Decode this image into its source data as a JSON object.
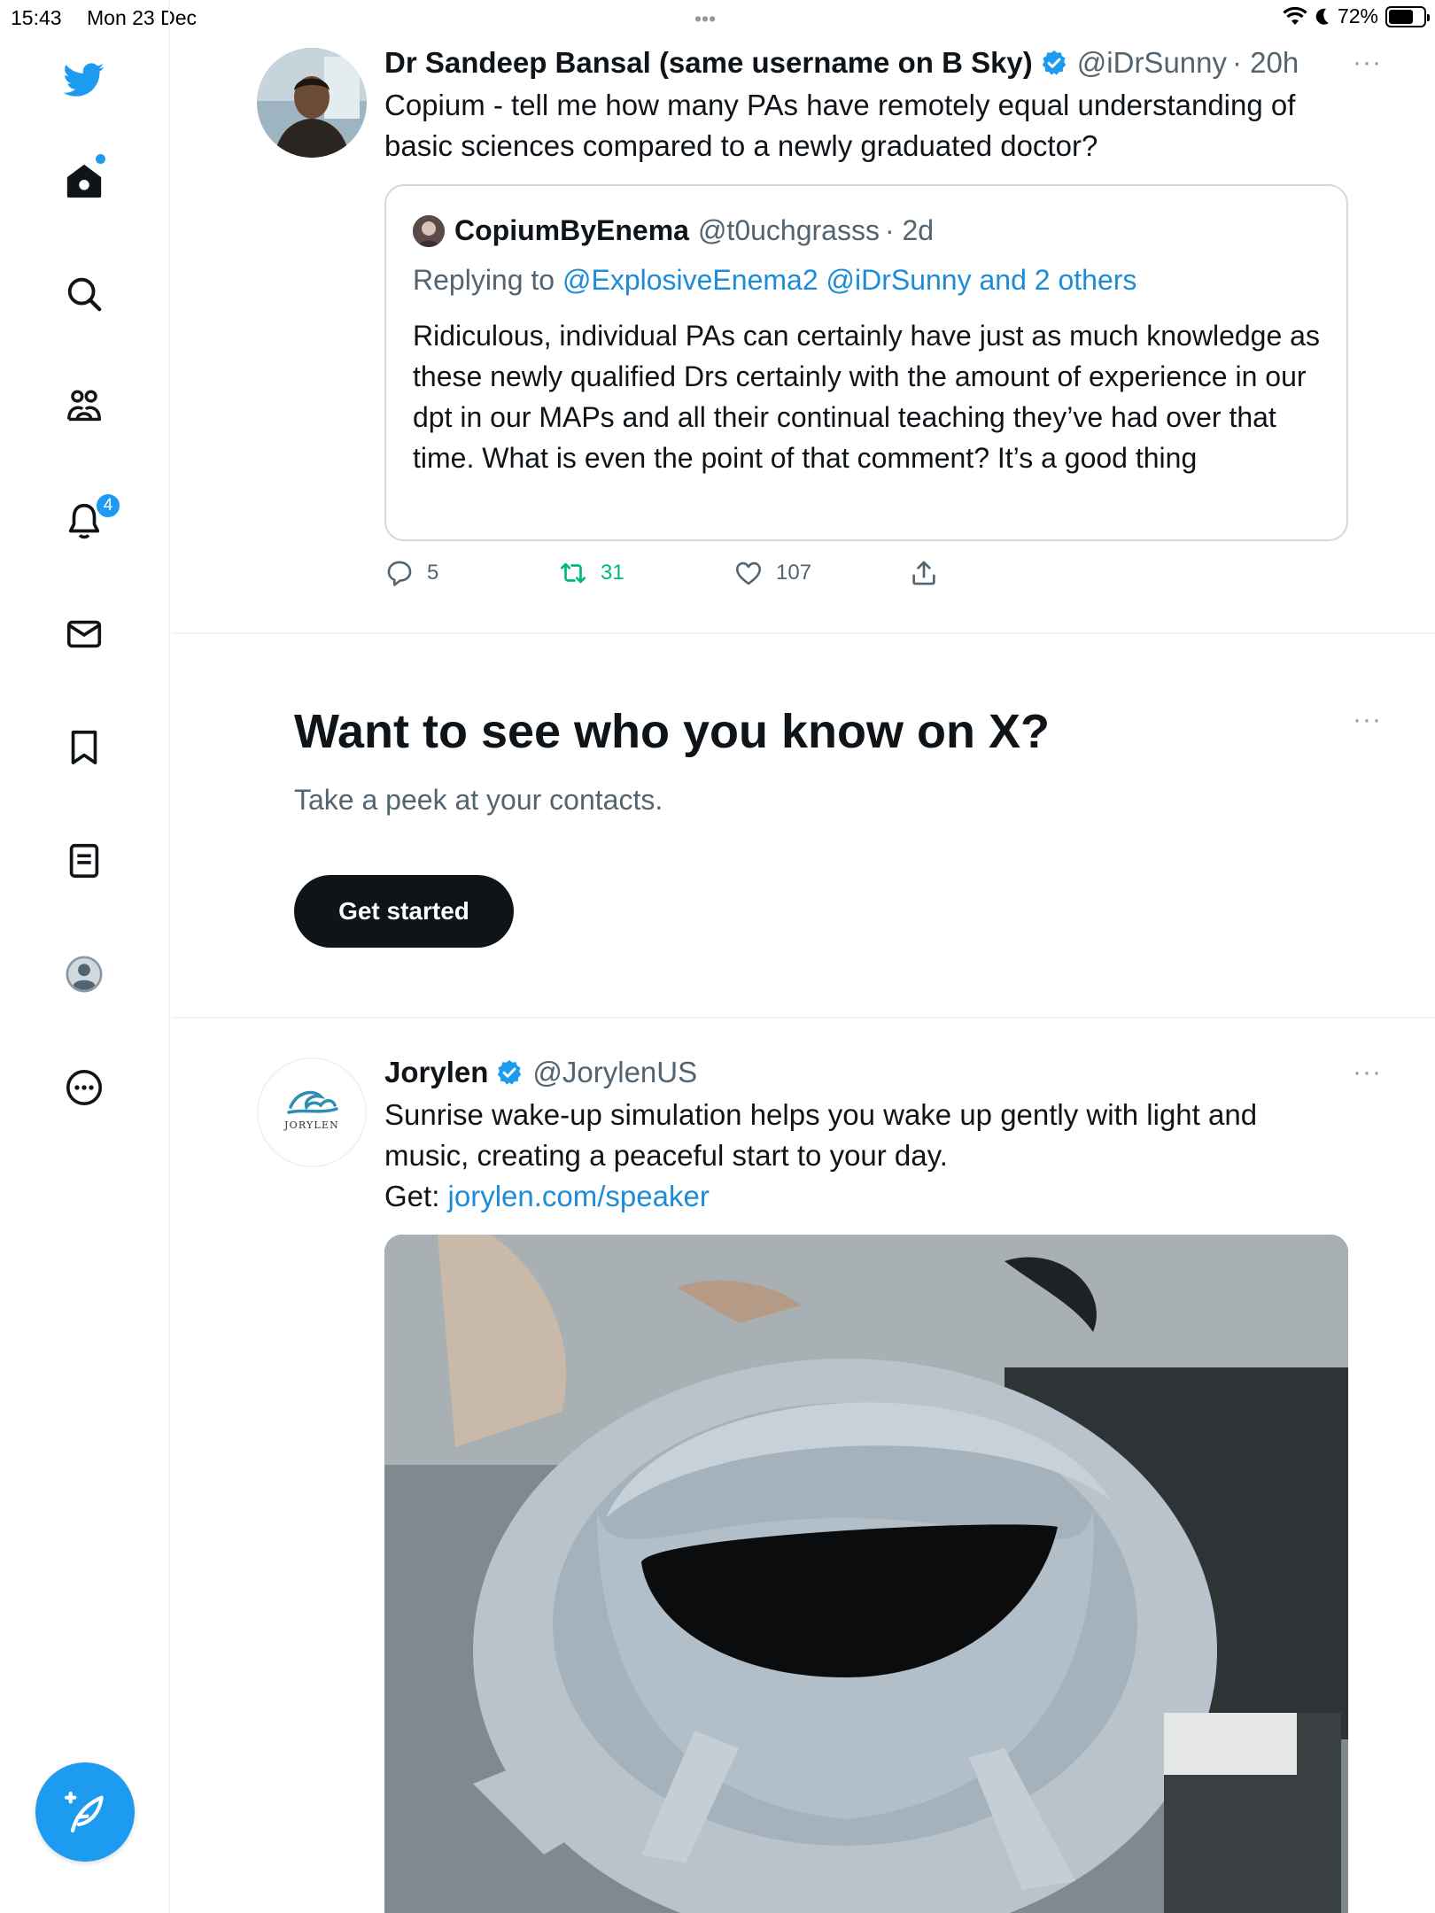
{
  "status_bar": {
    "time": "15:43",
    "date": "Mon 23 Dec",
    "dots": "•••",
    "battery_percent": "72%",
    "battery_level": 0.72
  },
  "sidebar": {
    "items": [
      {
        "name": "twitter-logo-icon"
      },
      {
        "name": "home-icon"
      },
      {
        "name": "search-icon"
      },
      {
        "name": "communities-icon"
      },
      {
        "name": "notifications-icon"
      },
      {
        "name": "messages-icon"
      },
      {
        "name": "bookmarks-icon"
      },
      {
        "name": "lists-icon"
      },
      {
        "name": "profile-icon"
      },
      {
        "name": "more-icon"
      }
    ],
    "notification_count": "4",
    "compose_icon": "compose-feather-icon"
  },
  "tweet1": {
    "name": "Dr Sandeep Bansal (same username on B Sky)",
    "handle": "@iDrSunny",
    "time": "· 20h",
    "more": "···",
    "text": "Copium - tell me how many PAs have remotely equal understanding of basic sciences compared to a newly graduated doctor?",
    "quote": {
      "name": "CopiumByEnema",
      "handle": "@t0uchgrasss",
      "time": "· 2d",
      "replying_prefix": "Replying to ",
      "replying_to": "@ExplosiveEnema2 @iDrSunny and 2 others",
      "text": "Ridiculous, individual PAs can certainly have just as much knowledge as these newly qualified Drs certainly with the amount of experience in our dpt in our MAPs and all their continual teaching they’ve had over that time. What is even the point of that comment? It’s a good thing"
    },
    "actions": {
      "replies": "5",
      "retweets": "31",
      "likes": "107"
    }
  },
  "promo": {
    "title": "Want to see who you know on X?",
    "subtitle": "Take a peek at your contacts.",
    "button": "Get started",
    "more": "···"
  },
  "tweet2": {
    "name": "Jorylen",
    "handle": "@JorylenUS",
    "more": "···",
    "text_line1": "Sunrise wake-up simulation helps you wake up gently with light and music, creating a peaceful start to your day.",
    "get_label": "Get: ",
    "link": "jorylen.com/speaker",
    "avatar_text": "JORYLEN"
  },
  "colors": {
    "accent": "#1d9bf0",
    "retweet_green": "#00ba7c",
    "text": "#0f1419",
    "muted": "#536471"
  }
}
